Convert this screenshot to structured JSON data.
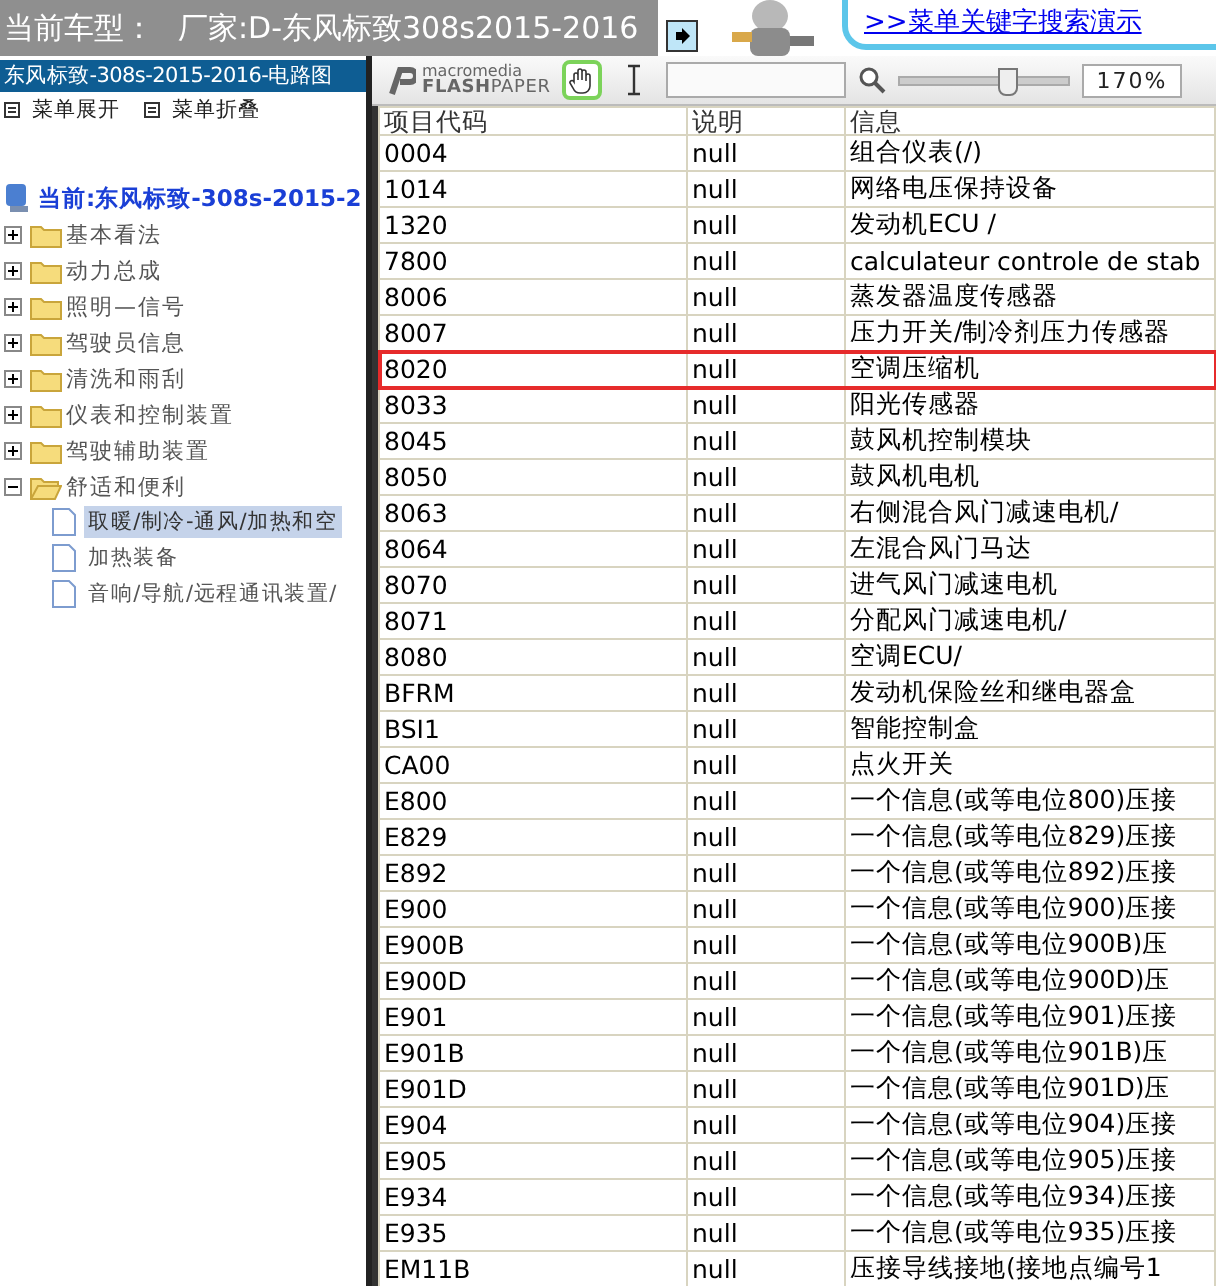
{
  "header": {
    "title": "当前车型：",
    "maker": "厂家:D-东风标致308s2015-2016",
    "link": ">>菜单关键字搜索演示"
  },
  "sidebar": {
    "title": "东风标致-308s-2015-2016-电路图",
    "actions": [
      {
        "label": "菜单展开"
      },
      {
        "label": "菜单折叠"
      }
    ],
    "tree": {
      "label": "当前:东风标致-308s-2015-2",
      "children": [
        {
          "label": "基本看法",
          "expanded": false
        },
        {
          "label": "动力总成",
          "expanded": false
        },
        {
          "label": "照明—信号",
          "expanded": false
        },
        {
          "label": "驾驶员信息",
          "expanded": false
        },
        {
          "label": "清洗和雨刮",
          "expanded": false
        },
        {
          "label": "仪表和控制装置",
          "expanded": false
        },
        {
          "label": "驾驶辅助装置",
          "expanded": false
        },
        {
          "label": "舒适和便利",
          "expanded": true,
          "children": [
            {
              "label": "取暖/制冷-通风/加热和空",
              "selected": true
            },
            {
              "label": "加热装备",
              "selected": false
            },
            {
              "label": "音响/导航/远程通讯装置/",
              "selected": false
            }
          ]
        }
      ]
    }
  },
  "viewer": {
    "logo_top": "macromedia",
    "logo_bottom": "**FLASH**PAPER",
    "tools": [
      {
        "kind": "hand",
        "selected": true
      },
      {
        "kind": "text",
        "selected": false
      }
    ],
    "zoom": {
      "level": 0.64,
      "reading": "170%"
    }
  },
  "table": {
    "columns": [
      "项目代码",
      "说明",
      "信息"
    ],
    "rows": [
      {
        "cells": [
          "0004",
          "null",
          "组合仪表(/)"
        ],
        "highlighted": false
      },
      {
        "cells": [
          "1014",
          "null",
          "网络电压保持设备"
        ],
        "highlighted": false
      },
      {
        "cells": [
          "1320",
          "null",
          "发动机ECU /"
        ],
        "highlighted": false
      },
      {
        "cells": [
          "7800",
          "null",
          "calculateur controle de stab"
        ],
        "highlighted": false
      },
      {
        "cells": [
          "8006",
          "null",
          "蒸发器温度传感器"
        ],
        "highlighted": false
      },
      {
        "cells": [
          "8007",
          "null",
          "压力开关/制冷剂压力传感器"
        ],
        "highlighted": false
      },
      {
        "cells": [
          "8020",
          "null",
          "空调压缩机"
        ],
        "highlighted": true
      },
      {
        "cells": [
          "8033",
          "null",
          "阳光传感器"
        ],
        "highlighted": false
      },
      {
        "cells": [
          "8045",
          "null",
          "鼓风机控制模块"
        ],
        "highlighted": false
      },
      {
        "cells": [
          "8050",
          "null",
          "鼓风机电机"
        ],
        "highlighted": false
      },
      {
        "cells": [
          "8063",
          "null",
          "右侧混合风门减速电机/"
        ],
        "highlighted": false
      },
      {
        "cells": [
          "8064",
          "null",
          "左混合风门马达"
        ],
        "highlighted": false
      },
      {
        "cells": [
          "8070",
          "null",
          "进气风门减速电机"
        ],
        "highlighted": false
      },
      {
        "cells": [
          "8071",
          "null",
          "分配风门减速电机/"
        ],
        "highlighted": false
      },
      {
        "cells": [
          "8080",
          "null",
          "空调ECU/"
        ],
        "highlighted": false
      },
      {
        "cells": [
          "BFRM",
          "null",
          "发动机保险丝和继电器盒"
        ],
        "highlighted": false
      },
      {
        "cells": [
          "BSI1",
          "null",
          "智能控制盒"
        ],
        "highlighted": false
      },
      {
        "cells": [
          "CA00",
          "null",
          "点火开关"
        ],
        "highlighted": false
      },
      {
        "cells": [
          "E800",
          "null",
          "一个信息(或等电位800)压接"
        ],
        "highlighted": false
      },
      {
        "cells": [
          "E829",
          "null",
          "一个信息(或等电位829)压接"
        ],
        "highlighted": false
      },
      {
        "cells": [
          "E892",
          "null",
          "一个信息(或等电位892)压接"
        ],
        "highlighted": false
      },
      {
        "cells": [
          "E900",
          "null",
          "一个信息(或等电位900)压接"
        ],
        "highlighted": false
      },
      {
        "cells": [
          "E900B",
          "null",
          "一个信息(或等电位900B)压"
        ],
        "highlighted": false
      },
      {
        "cells": [
          "E900D",
          "null",
          "一个信息(或等电位900D)压"
        ],
        "highlighted": false
      },
      {
        "cells": [
          "E901",
          "null",
          "一个信息(或等电位901)压接"
        ],
        "highlighted": false
      },
      {
        "cells": [
          "E901B",
          "null",
          "一个信息(或等电位901B)压"
        ],
        "highlighted": false
      },
      {
        "cells": [
          "E901D",
          "null",
          "一个信息(或等电位901D)压"
        ],
        "highlighted": false
      },
      {
        "cells": [
          "E904",
          "null",
          "一个信息(或等电位904)压接"
        ],
        "highlighted": false
      },
      {
        "cells": [
          "E905",
          "null",
          "一个信息(或等电位905)压接"
        ],
        "highlighted": false
      },
      {
        "cells": [
          "E934",
          "null",
          "一个信息(或等电位934)压接"
        ],
        "highlighted": false
      },
      {
        "cells": [
          "E935",
          "null",
          "一个信息(或等电位935)压接"
        ],
        "highlighted": false
      },
      {
        "cells": [
          "EM11B",
          "null",
          "压接导线接地(接地点编号1"
        ],
        "highlighted": false
      }
    ]
  }
}
